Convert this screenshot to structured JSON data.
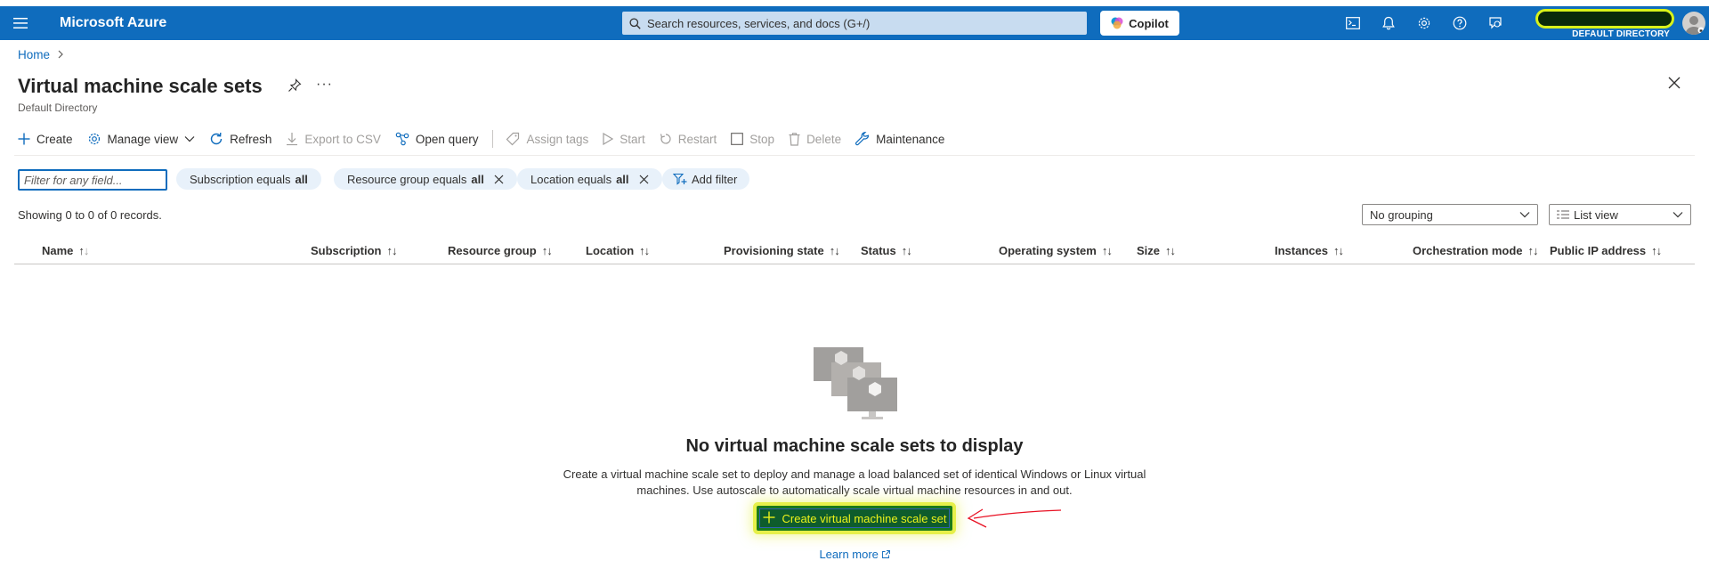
{
  "topbar": {
    "brand": "Microsoft Azure",
    "search_placeholder": "Search resources, services, and docs (G+/)",
    "copilot_label": "Copilot",
    "directory": "DEFAULT DIRECTORY",
    "bar_color": "#0f6cbd"
  },
  "breadcrumb": {
    "home": "Home"
  },
  "page": {
    "title": "Virtual machine scale sets",
    "subtitle": "Default Directory"
  },
  "toolbar": {
    "create": "Create",
    "manage_view": "Manage view",
    "refresh": "Refresh",
    "export_csv": "Export to CSV",
    "open_query": "Open query",
    "assign_tags": "Assign tags",
    "start": "Start",
    "restart": "Restart",
    "stop": "Stop",
    "delete": "Delete",
    "maintenance": "Maintenance"
  },
  "filters": {
    "placeholder": "Filter for any field...",
    "subscription_prefix": "Subscription equals",
    "subscription_value": "all",
    "resource_group_prefix": "Resource group equals",
    "resource_group_value": "all",
    "location_prefix": "Location equals",
    "location_value": "all",
    "add_filter": "Add filter"
  },
  "records_text": "Showing 0 to 0 of 0 records.",
  "grouping": {
    "selected": "No grouping"
  },
  "view": {
    "selected": "List view"
  },
  "columns": [
    "Name",
    "Subscription",
    "Resource group",
    "Location",
    "Provisioning state",
    "Status",
    "Operating system",
    "Size",
    "Instances",
    "Orchestration mode",
    "Public IP address"
  ],
  "empty_state": {
    "title": "No virtual machine scale sets to display",
    "description_line1": "Create a virtual machine scale set to deploy and manage a load balanced set of identical Windows or Linux virtual",
    "description_line2": "machines. Use autoscale to automatically scale virtual machine resources in and out.",
    "create_button": "Create virtual machine scale set",
    "learn_more": "Learn more"
  }
}
